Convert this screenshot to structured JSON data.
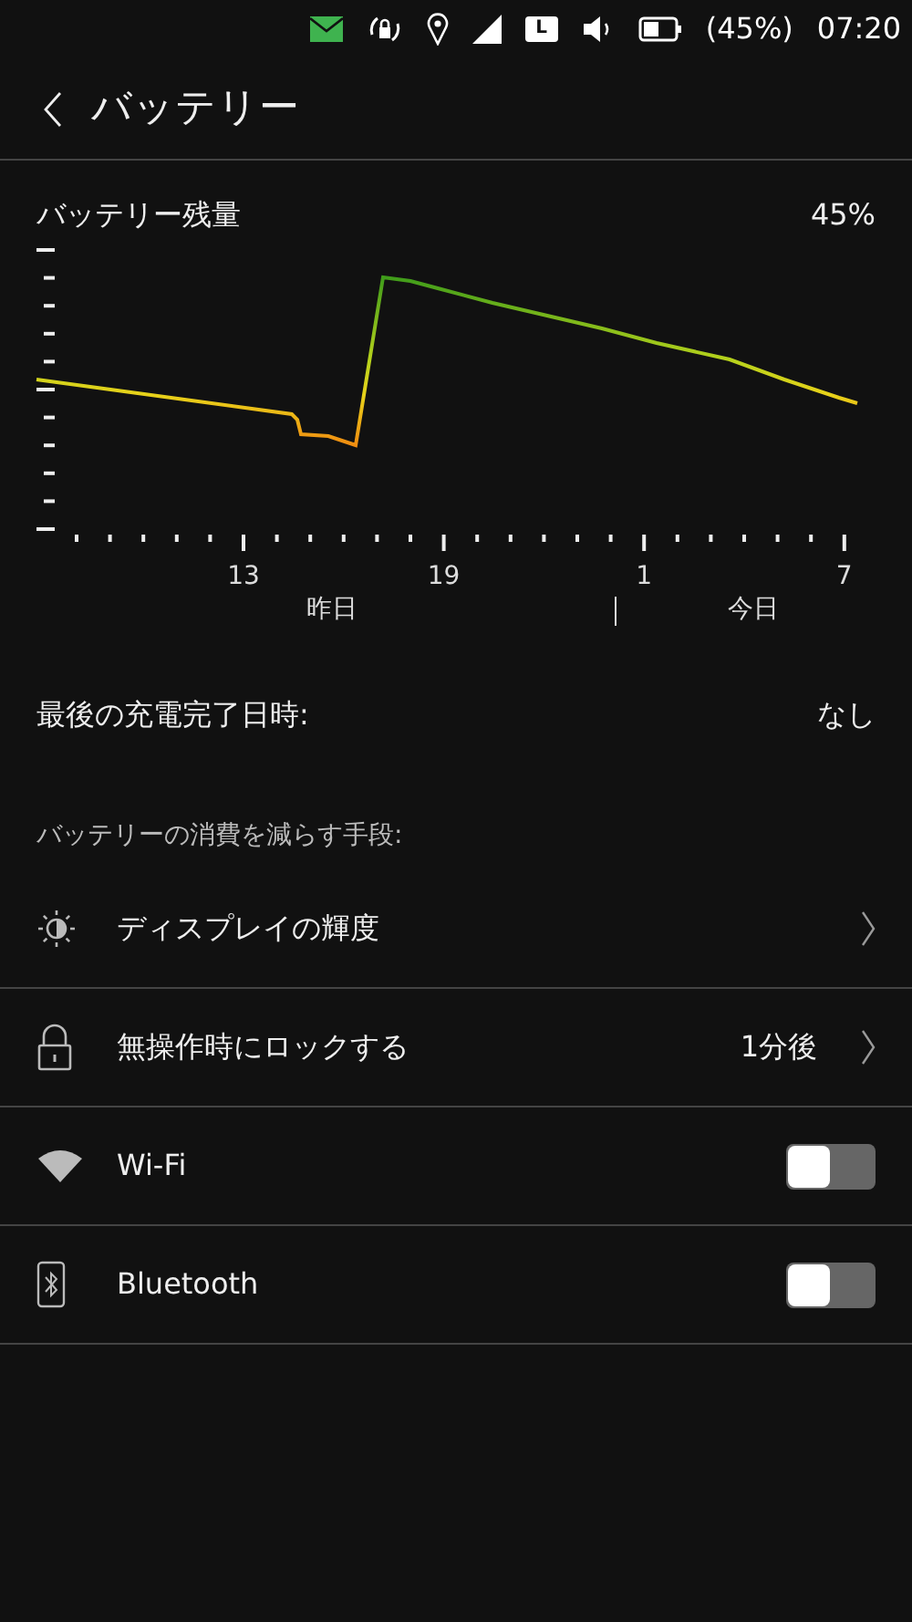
{
  "status_bar": {
    "network_badge": "L",
    "battery": "(45%)",
    "time": "07:20"
  },
  "header": {
    "title": "バッテリー"
  },
  "battery_level": {
    "label": "バッテリー残量",
    "value": "45%"
  },
  "graph": {
    "x_labels": [
      "13",
      "19",
      "1",
      "7"
    ],
    "day_labels": [
      "昨日",
      "今日"
    ]
  },
  "last_full_charge": {
    "label": "最後の充電完了日時:",
    "value": "なし"
  },
  "section_header": "バッテリーの消費を減らす手段:",
  "rows": [
    {
      "kind": "link",
      "label": "ディスプレイの輝度"
    },
    {
      "kind": "link",
      "label": "無操作時にロックする",
      "value": "1分後"
    },
    {
      "kind": "toggle",
      "label": "Wi-Fi",
      "on": false
    },
    {
      "kind": "toggle",
      "label": "Bluetooth",
      "on": false
    }
  ]
}
